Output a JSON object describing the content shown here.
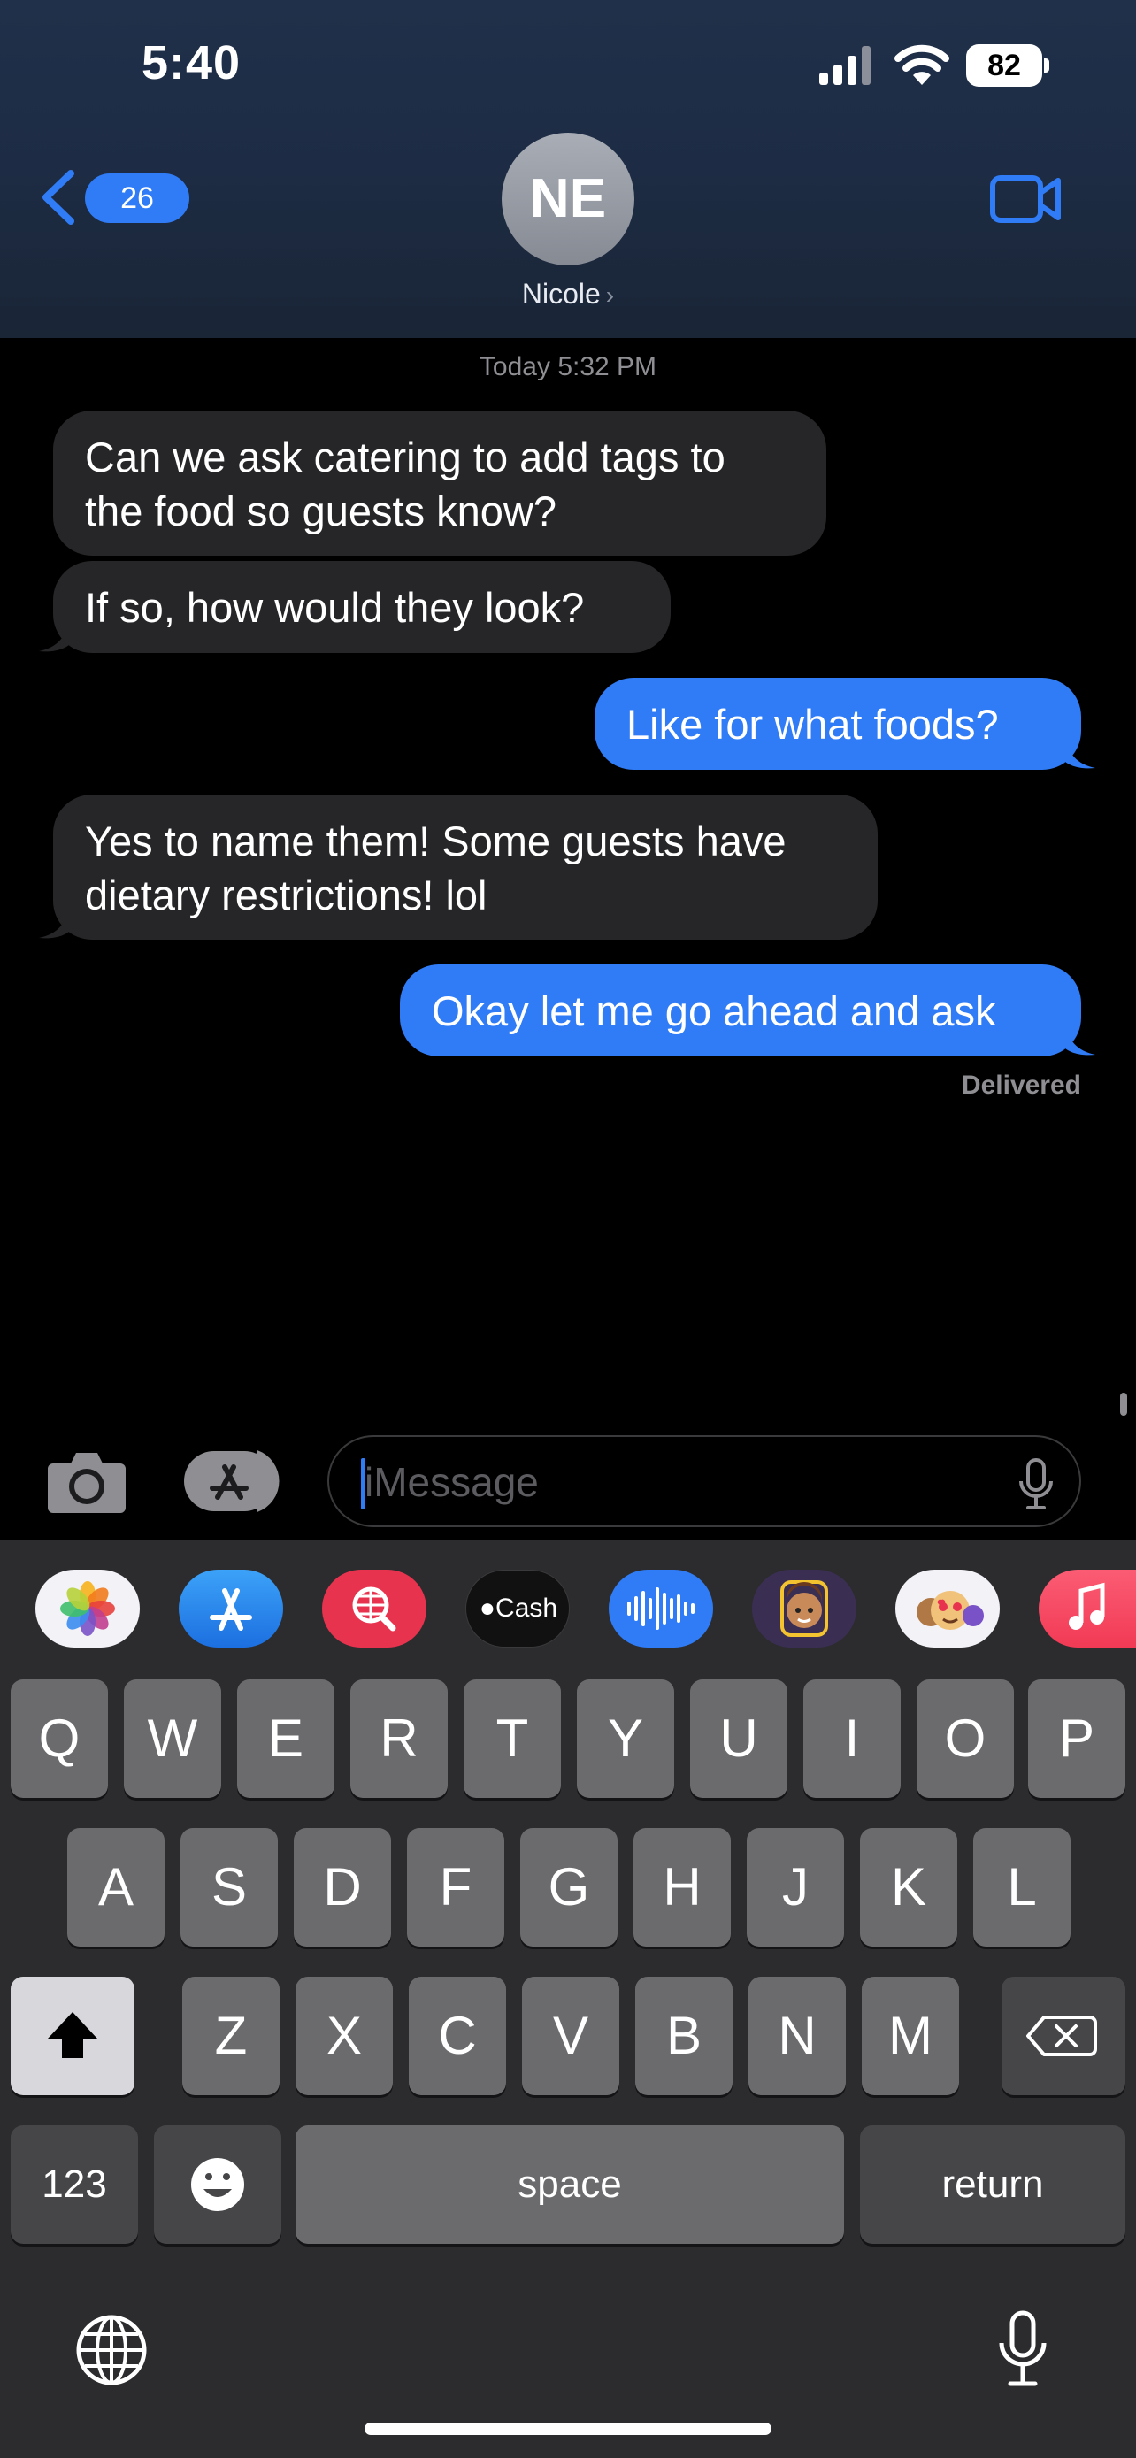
{
  "status_bar": {
    "time": "5:40",
    "battery": "82"
  },
  "header": {
    "back_count": "26",
    "avatar_initials": "NE",
    "contact_name": "Nicole"
  },
  "conversation": {
    "timestamp_day": "Today",
    "timestamp_time": "5:32 PM",
    "messages": [
      {
        "from": "them",
        "text_lines": [
          "Can we ask catering to add tags to",
          "the food so guests know?"
        ]
      },
      {
        "from": "them",
        "text_lines": [
          "If so, how would they look?"
        ]
      },
      {
        "from": "me",
        "text_lines": [
          "Like for what foods?"
        ]
      },
      {
        "from": "them",
        "text_lines": [
          "Yes to name them! Some guests have",
          "dietary restrictions! lol"
        ]
      },
      {
        "from": "me",
        "text_lines": [
          "Okay let me go ahead and ask"
        ]
      }
    ],
    "delivered_label": "Delivered"
  },
  "composer": {
    "placeholder": "iMessage"
  },
  "app_drawer": {
    "apps": [
      "photos-icon",
      "app-store-icon",
      "image-search-icon",
      "apple-cash-icon",
      "audio-message-icon",
      "memoji-icon",
      "memoji-stickers-icon",
      "music-icon"
    ],
    "cash_label": "Cash"
  },
  "keyboard": {
    "row1": [
      "Q",
      "W",
      "E",
      "R",
      "T",
      "Y",
      "U",
      "I",
      "O",
      "P"
    ],
    "row2": [
      "A",
      "S",
      "D",
      "F",
      "G",
      "H",
      "J",
      "K",
      "L"
    ],
    "row3": [
      "Z",
      "X",
      "C",
      "V",
      "B",
      "N",
      "M"
    ],
    "numbers_label": "123",
    "space_label": "space",
    "return_label": "return"
  },
  "colors": {
    "accent": "#2f7cf6",
    "bubble_incoming": "#262628",
    "keyboard_bg": "#2c2c2e"
  }
}
